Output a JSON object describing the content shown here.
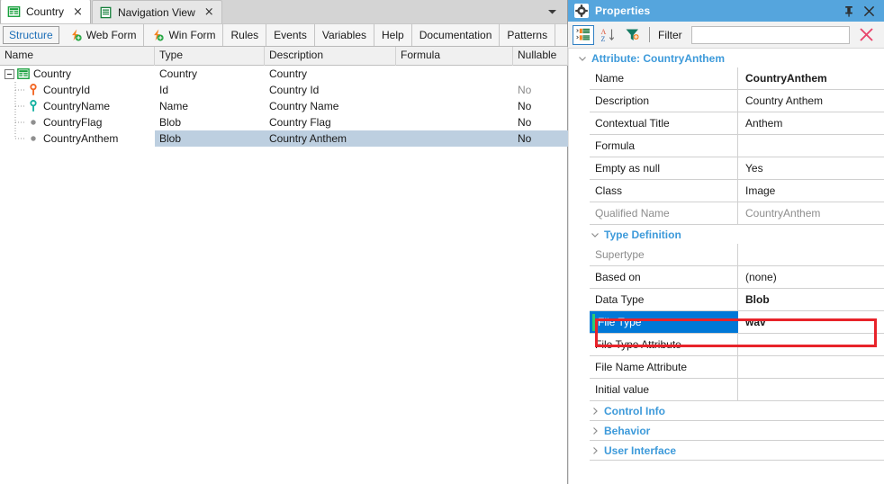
{
  "editor": {
    "tabs": [
      {
        "label": "Country",
        "icon": "table-icon",
        "active": true,
        "close": "×"
      },
      {
        "label": "Navigation View",
        "icon": "list-icon",
        "active": false,
        "close": "×"
      }
    ],
    "tab_overflow_icon": "chevron-down-icon",
    "subtabs": [
      {
        "label": "Structure",
        "icon": null,
        "selected": true
      },
      {
        "label": "Web Form",
        "icon": "lightning-plus-icon",
        "selected": false
      },
      {
        "label": "Win Form",
        "icon": "lightning-plus-icon",
        "selected": false
      },
      {
        "label": "Rules",
        "icon": null,
        "selected": false
      },
      {
        "label": "Events",
        "icon": null,
        "selected": false
      },
      {
        "label": "Variables",
        "icon": null,
        "selected": false
      },
      {
        "label": "Help",
        "icon": null,
        "selected": false
      },
      {
        "label": "Documentation",
        "icon": null,
        "selected": false
      },
      {
        "label": "Patterns",
        "icon": null,
        "selected": false
      }
    ],
    "grid": {
      "columns": [
        "Name",
        "Type",
        "Description",
        "Formula",
        "Nullable"
      ],
      "rows": [
        {
          "name": "Country",
          "icon": "transaction-icon",
          "indent": 0,
          "expanded": true,
          "type": "Country",
          "description": "Country",
          "formula": "",
          "nullable": "",
          "selected": false
        },
        {
          "name": "CountryId",
          "icon": "primary-key-icon",
          "indent": 1,
          "expanded": false,
          "type": "Id",
          "description": "Country Id",
          "formula": "",
          "nullable": "No",
          "nullable_dim": true,
          "selected": false
        },
        {
          "name": "CountryName",
          "icon": "candidate-key-icon",
          "indent": 1,
          "expanded": false,
          "type": "Name",
          "description": "Country Name",
          "formula": "",
          "nullable": "No",
          "selected": false
        },
        {
          "name": "CountryFlag",
          "icon": "attribute-dot-icon",
          "indent": 1,
          "expanded": false,
          "type": "Blob",
          "description": "Country Flag",
          "formula": "",
          "nullable": "No",
          "selected": false
        },
        {
          "name": "CountryAnthem",
          "icon": "attribute-dot-icon",
          "indent": 1,
          "expanded": false,
          "type": "Blob",
          "description": "Country Anthem",
          "formula": "",
          "nullable": "No",
          "selected": true
        }
      ]
    }
  },
  "properties": {
    "title": "Properties",
    "title_icon": "gear-icon",
    "pin_icon": "pin-icon",
    "close_icon": "close-icon",
    "toolbar": {
      "categorized_icon": "categorized-list-icon",
      "sort_az_icon": "sort-alphabetical-icon",
      "filter_icon": "funnel-icon",
      "filter_label": "Filter",
      "filter_value": "",
      "filter_placeholder": "",
      "clear_icon": "clear-x-icon"
    },
    "sections": [
      {
        "name": "Attribute: CountryAnthem",
        "expanded": true,
        "level": 0,
        "rows": [
          {
            "key": "Name",
            "value": "CountryAnthem",
            "bold_value": true
          },
          {
            "key": "Description",
            "value": "Country Anthem"
          },
          {
            "key": "Contextual Title",
            "value": "Anthem"
          },
          {
            "key": "Formula",
            "value": ""
          },
          {
            "key": "Empty as null",
            "value": "Yes"
          },
          {
            "key": "Class",
            "value": "Image"
          },
          {
            "key": "Qualified Name",
            "value": "CountryAnthem",
            "dim": true
          }
        ]
      },
      {
        "name": "Type Definition",
        "expanded": true,
        "level": 1,
        "rows": [
          {
            "key": "Supertype",
            "value": "",
            "dim": true
          },
          {
            "key": "Based on",
            "value": "(none)"
          },
          {
            "key": "Data Type",
            "value": "Blob",
            "bold_value": true
          },
          {
            "key": "File Type",
            "value": "wav",
            "bold_value": true,
            "selected": true,
            "highlighted": true
          },
          {
            "key": "File Type Attribute",
            "value": ""
          },
          {
            "key": "File Name Attribute",
            "value": ""
          },
          {
            "key": "Initial value",
            "value": ""
          }
        ]
      },
      {
        "name": "Control Info",
        "expanded": false,
        "level": 1,
        "rows": []
      },
      {
        "name": "Behavior",
        "expanded": false,
        "level": 1,
        "rows": []
      },
      {
        "name": "User Interface",
        "expanded": false,
        "level": 1,
        "rows": []
      }
    ]
  },
  "annotation": {
    "type": "red-rectangle",
    "target": "File Type",
    "color": "#e8232a"
  },
  "colors": {
    "title_bar": "#55a5dd",
    "selection_blue": "#0078d7",
    "grid_selection": "#bdcfe0",
    "category_text": "#3d9ada",
    "accent_red": "#e8232a",
    "sub_tab_selected_text": "#1d6fb8"
  }
}
